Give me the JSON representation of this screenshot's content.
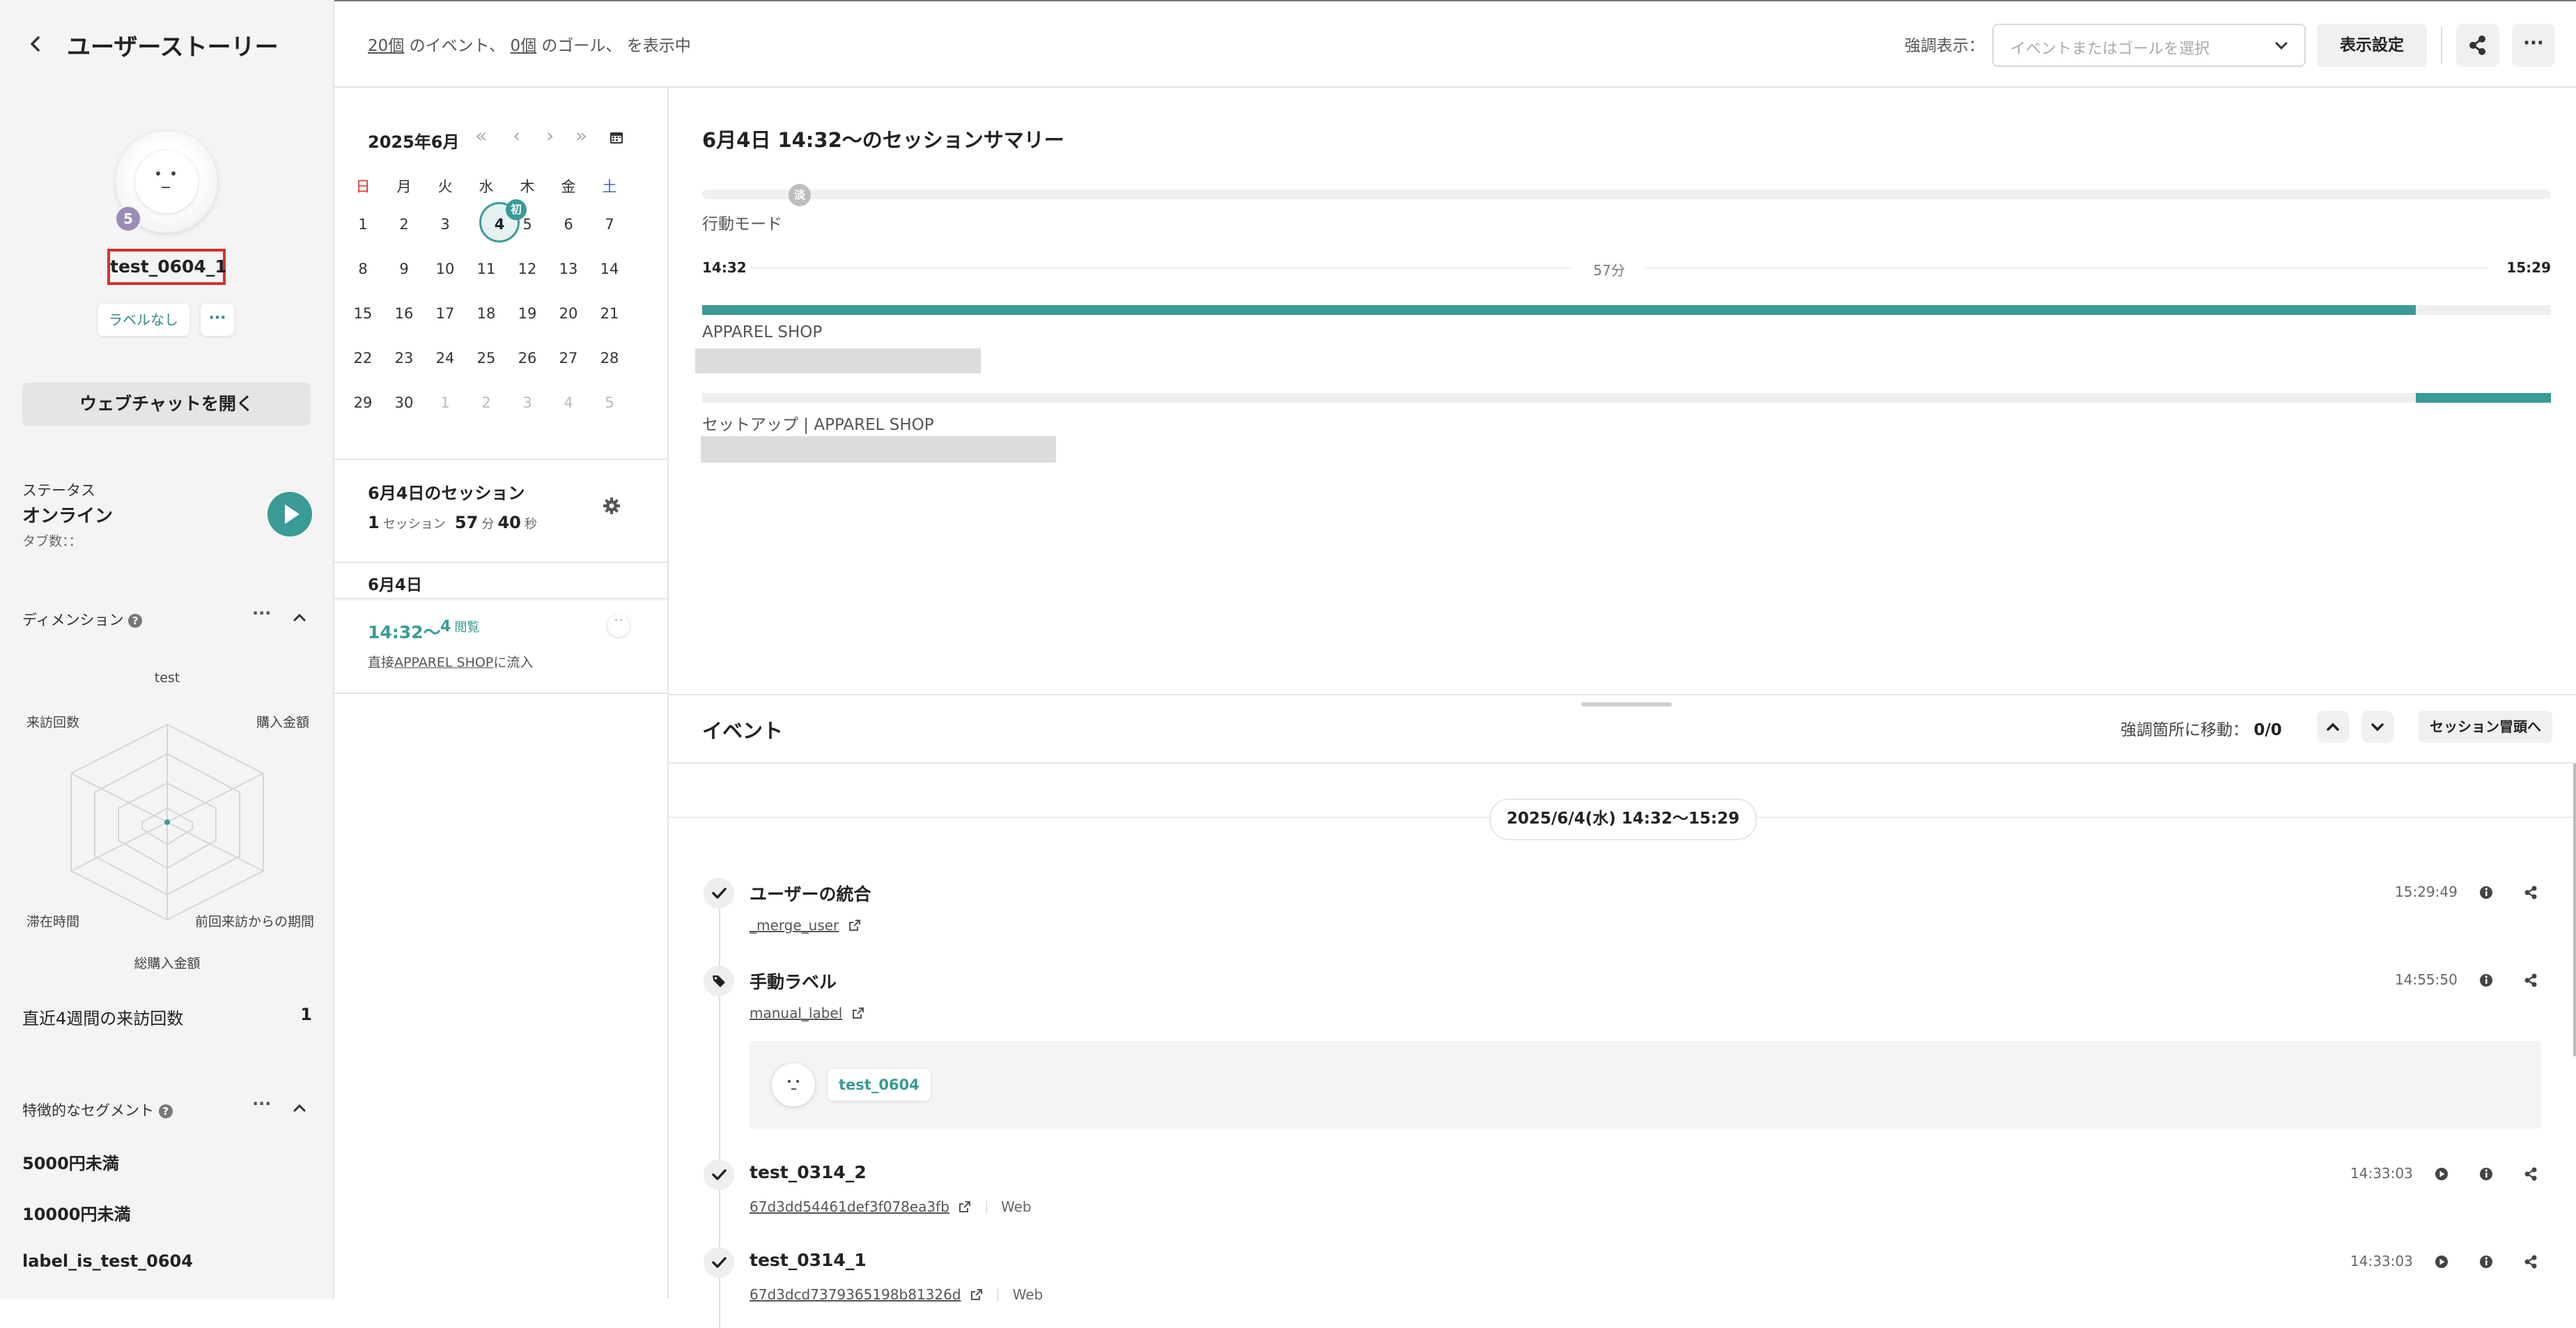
{
  "sidebar": {
    "title": "ユーザーストーリー",
    "avatar_badge": "5",
    "user_name": "test_0604_1",
    "label_chip": "ラベルなし",
    "more_chip": "···",
    "webchat_button": "ウェブチャットを開く",
    "status_label": "ステータス",
    "status_value": "オンライン",
    "tab_count": "タブ数：：",
    "dimension_title": "ディメンション",
    "radar_labels": {
      "top": "test",
      "top_left": "来訪回数",
      "top_right": "購入金額",
      "bottom_left": "滞在時間",
      "bottom_right": "前回来訪からの期間",
      "bottom": "総購入金額"
    },
    "visits_label": "直近4週間の来訪回数",
    "visits_value": "1",
    "segment_title": "特徴的なセグメント",
    "segments": [
      "5000円未満",
      "10000円未満",
      "label_is_test_0604"
    ]
  },
  "header": {
    "events_count": "20個",
    "events_text": "のイベント、",
    "goals_count": "0個",
    "goals_text": "のゴール、 を表示中",
    "highlight_label": "強調表示：",
    "highlight_placeholder": "イベントまたはゴールを選択",
    "display_settings": "表示設定"
  },
  "calendar": {
    "month": "2025年6月",
    "weekdays": [
      "日",
      "月",
      "火",
      "水",
      "木",
      "金",
      "土"
    ],
    "weeks": [
      [
        "1",
        "2",
        "3",
        "4",
        "5",
        "6",
        "7"
      ],
      [
        "8",
        "9",
        "10",
        "11",
        "12",
        "13",
        "14"
      ],
      [
        "15",
        "16",
        "17",
        "18",
        "19",
        "20",
        "21"
      ],
      [
        "22",
        "23",
        "24",
        "25",
        "26",
        "27",
        "28"
      ],
      [
        "29",
        "30",
        "1",
        "2",
        "3",
        "4",
        "5"
      ]
    ],
    "first_badge": "初",
    "nav": [
      "«",
      "‹",
      "›",
      "»"
    ]
  },
  "sessions": {
    "day_title": "6月4日のセッション",
    "count": "1",
    "count_unit": "セッション",
    "minutes": "57",
    "min_unit": "分",
    "seconds": "40",
    "sec_unit": "秒",
    "date_header": "6月4日",
    "item_time": "14:32〜",
    "item_views": "4",
    "item_views_unit": "閲覧",
    "item_source_pre": "直接",
    "item_source_link": "APPAREL SHOP",
    "item_source_post": "に流入"
  },
  "summary": {
    "title": "6月4日 14:32〜のセッションサマリー",
    "mode_marker": "淡",
    "mode_label": "行動モード",
    "start_time": "14:32",
    "duration": "57分",
    "end_time": "15:29",
    "bars": [
      {
        "label": "APPAREL SHOP",
        "share": 0.926
      },
      {
        "label": "セットアップ | APPAREL SHOP",
        "share": 0.074
      }
    ]
  },
  "events": {
    "title": "イベント",
    "jump_label": "強調箇所に移動：",
    "jump_count": "0/0",
    "session_top": "セッション冒頭へ",
    "date_pill": "2025/6/4(水) 14:32〜15:29",
    "items": [
      {
        "title": "ユーザーの統合",
        "sub": "_merge_user",
        "time": "15:29:49"
      },
      {
        "title": "手動ラベル",
        "sub": "manual_label",
        "time": "14:55:50",
        "chip": "test_0604"
      },
      {
        "title": "test_0314_2",
        "sub": "67d3dd54461def3f078ea3fb",
        "tag": "Web",
        "time": "14:33:03"
      },
      {
        "title": "test_0314_1",
        "sub": "67d3dcd7379365198b81326d",
        "tag": "Web",
        "time": "14:33:03"
      }
    ]
  },
  "colors": {
    "accent": "#3a9a96",
    "highlight_red": "#d0342c",
    "badge_purple": "#9a8cb5"
  }
}
